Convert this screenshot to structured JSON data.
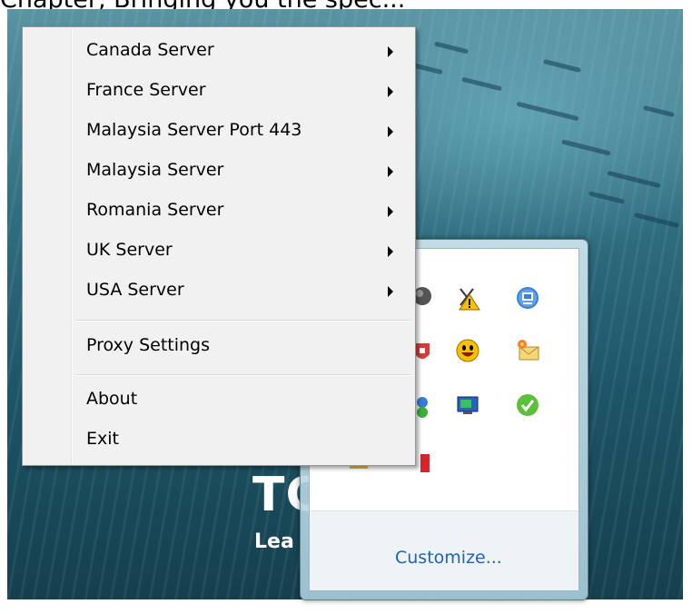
{
  "top_text": "Chapter, Bringing you the spec...",
  "desktop": {
    "text_big": "TC",
    "text_small": "Lea"
  },
  "menu": {
    "items": [
      {
        "label": "Canada Server",
        "submenu": true
      },
      {
        "label": "France Server",
        "submenu": true
      },
      {
        "label": "Malaysia Server Port 443",
        "submenu": true
      },
      {
        "label": "Malaysia Server",
        "submenu": true
      },
      {
        "label": "Romania Server",
        "submenu": true
      },
      {
        "label": "UK Server",
        "submenu": true
      },
      {
        "label": "USA Server",
        "submenu": true
      },
      {
        "label": "Proxy Settings",
        "submenu": false
      },
      {
        "label": "About",
        "submenu": false
      },
      {
        "label": "Exit",
        "submenu": false
      }
    ]
  },
  "tray": {
    "customize_label": "Customize...",
    "icons": [
      "network-warning-icon",
      "computer-icon",
      "smiley-icon",
      "mail-icon",
      "network-screen-icon",
      "check-icon",
      "user-icon",
      "flag-icon",
      "globe-icon",
      "shield-icon",
      "green-person-icon"
    ]
  },
  "colors": {
    "menu_bg": "#f1f1f1",
    "link_blue": "#1e64b4",
    "desktop_teal": "#2f6e80"
  }
}
